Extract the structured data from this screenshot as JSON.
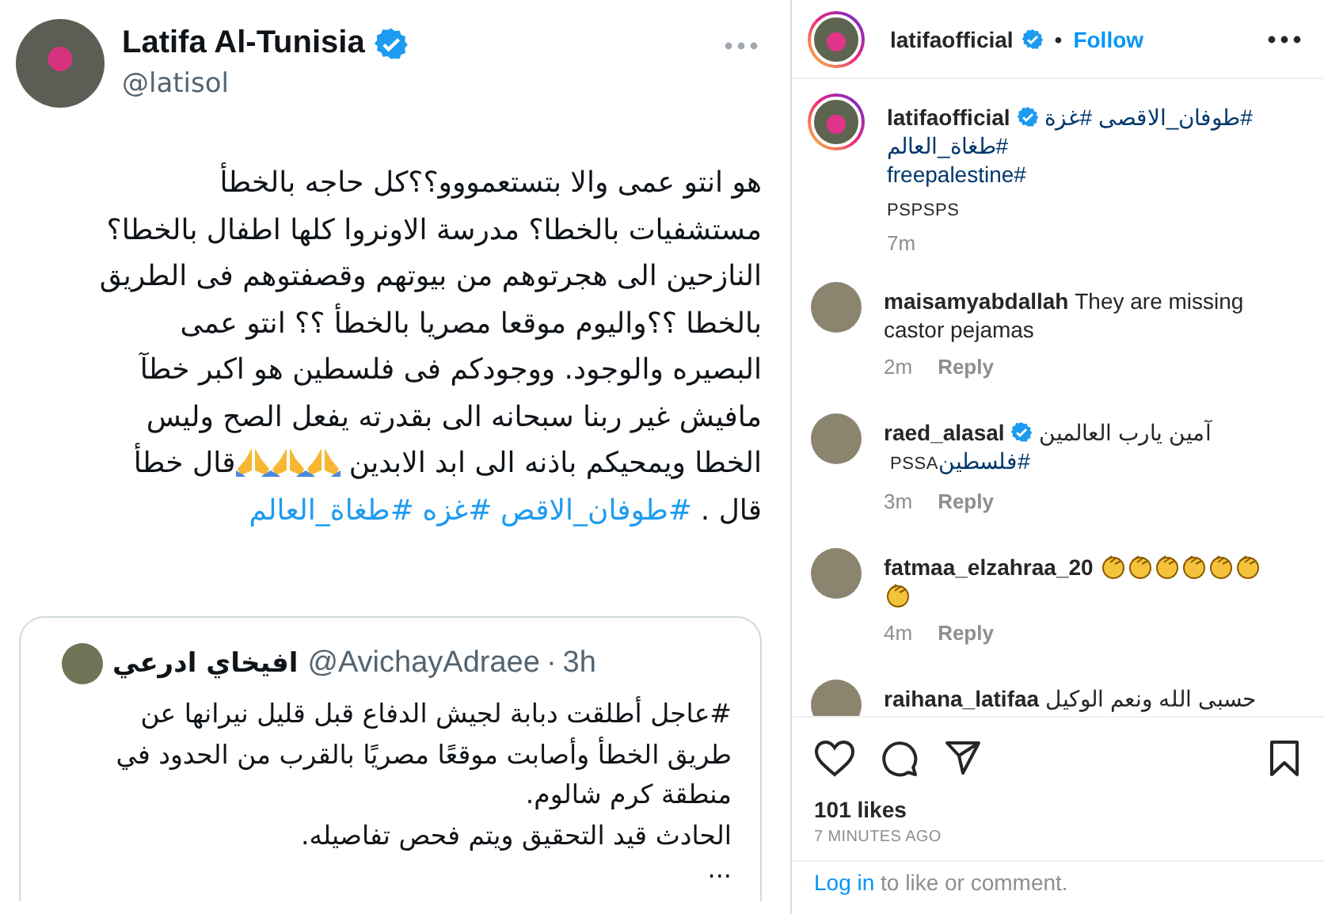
{
  "tweet": {
    "author": {
      "name": "Latifa Al-Tunisia",
      "verified": true,
      "handle": "@latisol"
    },
    "lines": [
      [
        {
          "kind": "text",
          "text": "هو انتو عمى والا بتستعمووو؟؟كل حاجه بالخطأ"
        }
      ],
      [
        {
          "kind": "text",
          "text": "مستشفيات بالخطا؟  مدرسة الاونروا كلها اطفال بالخطا؟"
        }
      ],
      [
        {
          "kind": "text",
          "text": "النازحين الى هجرتوهم من بيوتهم وقصفتوهم فى الطريق"
        }
      ],
      [
        {
          "kind": "text",
          "text": "بالخطا ؟؟واليوم موقعا مصريا بالخطأ ؟؟ انتو عمى"
        }
      ],
      [
        {
          "kind": "text",
          "text": "البصيره والوجود.  ووجودكم فى فلسطين هو اكبر خطآ"
        }
      ],
      [
        {
          "kind": "text",
          "text": "مافيش غير ربنا سبحانه الى بقدرته يفعل الصح وليس"
        }
      ],
      [
        {
          "kind": "text",
          "text": "الخطا ويمحيكم باذنه الى ابد الابدين "
        },
        {
          "kind": "pray"
        },
        {
          "kind": "pray"
        },
        {
          "kind": "pray"
        },
        {
          "kind": "text",
          "text": "قال خطأ"
        }
      ],
      [
        {
          "kind": "text",
          "text": "قال ."
        },
        {
          "kind": "hashtag",
          "text": "#طوفان_الاقص"
        },
        {
          "kind": "hashtag",
          "text": "#غزه"
        },
        {
          "kind": "hashtag",
          "text": "#طغاة_العالم"
        }
      ]
    ],
    "quote": {
      "name": "افيخاي ادرعي",
      "handle": "@AvichayAdraee",
      "separator": "·",
      "time": "3h",
      "lines": [
        "#عاجل أطلقت دبابة لجيش الدفاع قبل قليل نيرانها عن",
        "طريق الخطأ وأصابت موقعًا مصريًا بالقرب من الحدود في",
        "منطقة كرم شالوم.",
        "الحادث قيد التحقيق ويتم فحص تفاصيله."
      ],
      "more": "..."
    }
  },
  "post": {
    "header": {
      "username": "latifaofficial",
      "verified": true,
      "separator": "•",
      "follow": "Follow"
    },
    "caption": {
      "username": "latifaofficial",
      "verified": true,
      "lines": [
        [
          {
            "kind": "hashtag",
            "text": "#طوفان_الاقصى #غزة"
          }
        ],
        [
          {
            "kind": "hashtag",
            "text": "#طغاة_العالم"
          }
        ],
        [
          {
            "kind": "hashtag",
            "text": "freepalestine#"
          }
        ]
      ],
      "note": "PSPSPS",
      "time": "7m"
    },
    "comments": [
      {
        "username": "maisamyabdallah",
        "verified": false,
        "lines": [
          [
            {
              "kind": "text",
              "text": "They are missing"
            }
          ],
          [
            {
              "kind": "text",
              "text": "castor pejamas"
            }
          ]
        ],
        "time": "2m",
        "reply": "Reply"
      },
      {
        "username": "raed_alasal",
        "verified": true,
        "lines": [
          [
            {
              "kind": "text",
              "text": "آمين يارب العالمين"
            }
          ],
          [
            {
              "kind": "hashtag",
              "text": "#فلسطين"
            },
            {
              "kind": "note",
              "text": "PSSA"
            }
          ]
        ],
        "time": "3m",
        "reply": "Reply"
      },
      {
        "username": "fatmaa_elzahraa_20",
        "verified": false,
        "lines": [
          [
            {
              "kind": "clap"
            },
            {
              "kind": "clap"
            },
            {
              "kind": "clap"
            },
            {
              "kind": "clap"
            },
            {
              "kind": "clap"
            },
            {
              "kind": "clap"
            }
          ],
          [
            {
              "kind": "clap"
            }
          ]
        ],
        "time": "4m",
        "reply": "Reply"
      },
      {
        "username": "raihana_latifaa",
        "verified": false,
        "lines": [
          [
            {
              "kind": "text",
              "text": "حسبى الله ونعم الوكيل"
            }
          ]
        ]
      }
    ],
    "likes": "101 likes",
    "time": "7 MINUTES AGO",
    "login": {
      "link": "Log in",
      "text": " to like or comment."
    }
  }
}
